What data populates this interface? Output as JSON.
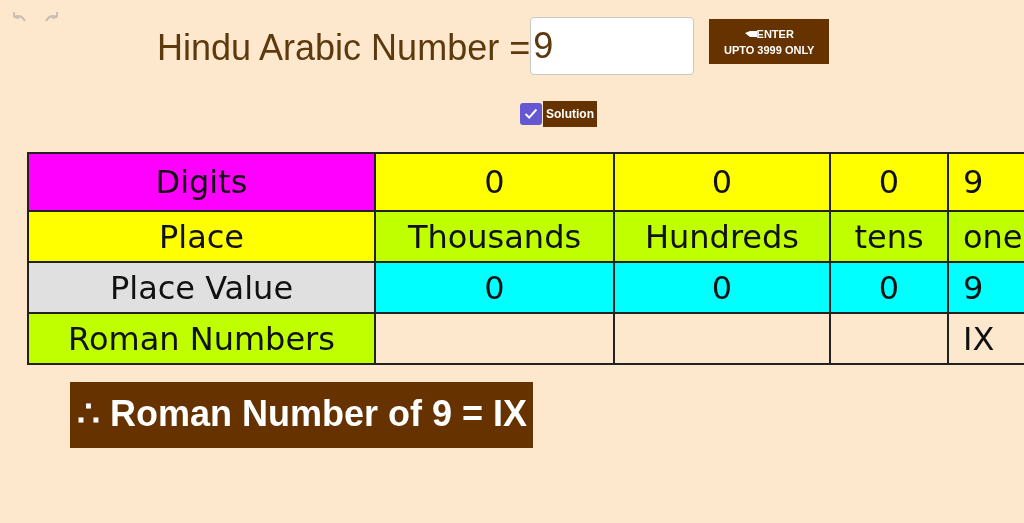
{
  "toolbar": {
    "undo_disabled": true,
    "redo_disabled": true
  },
  "number_label": "Hindu Arabic Number =",
  "number_input": {
    "value": "9"
  },
  "enter_button": {
    "line_1": "ENTER",
    "line_2": "UPTO 3999 ONLY"
  },
  "solution_checkbox": {
    "label": "Solution",
    "checked": true
  },
  "table": {
    "rows": [
      {
        "header": {
          "label": "Digits",
          "color": "#ff00ff"
        },
        "color": "#ffff00",
        "cells": [
          "0",
          "0",
          "0",
          "9"
        ]
      },
      {
        "header": {
          "label": "Place",
          "color": "#ffff00"
        },
        "color": "#bfff00",
        "cells": [
          "Thousands",
          "Hundreds",
          "tens",
          "one"
        ]
      },
      {
        "header": {
          "label": "Place Value",
          "color": "#e0e0e0"
        },
        "color": "#00ffff",
        "cells": [
          "0",
          "0",
          "0",
          "9"
        ]
      },
      {
        "header": {
          "label": "Roman Numbers",
          "color": "#bfff00"
        },
        "cells": [
          "",
          "",
          "",
          "IX"
        ]
      }
    ]
  },
  "result": "∴ Roman Number of 9 = IX"
}
